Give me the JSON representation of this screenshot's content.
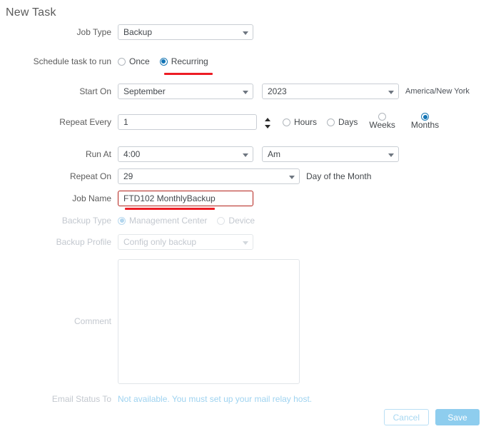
{
  "page_title": "New Task",
  "fields": {
    "job_type": {
      "label": "Job Type",
      "value": "Backup"
    },
    "schedule": {
      "label": "Schedule task to run",
      "option_once": "Once",
      "option_recurring": "Recurring"
    },
    "start_on": {
      "label": "Start On",
      "month": "September",
      "year": "2023",
      "timezone": "America/New York"
    },
    "repeat_every": {
      "label": "Repeat Every",
      "value": "1",
      "unit_hours": "Hours",
      "unit_days": "Days",
      "unit_weeks": "Weeks",
      "unit_months": "Months"
    },
    "run_at": {
      "label": "Run At",
      "time": "4:00",
      "meridiem": "Am"
    },
    "repeat_on": {
      "label": "Repeat On",
      "value": "29",
      "suffix": "Day of the Month"
    },
    "job_name": {
      "label": "Job Name",
      "value": "FTD102 MonthlyBackup"
    },
    "backup_type": {
      "label": "Backup Type",
      "option_management_center": "Management Center",
      "option_device": "Device"
    },
    "backup_profile": {
      "label": "Backup Profile",
      "value": "Config only backup"
    },
    "comment": {
      "label": "Comment",
      "value": ""
    },
    "email_status_to": {
      "label": "Email Status To",
      "message": "Not available. You must set up your mail relay host."
    }
  },
  "footer": {
    "cancel_label": "Cancel",
    "save_label": "Save"
  },
  "colors": {
    "accent_blue": "#1074b5",
    "annotation_red": "#ed1c24",
    "disabled_gray": "#c3c8cf",
    "save_button": "#8ecdee"
  }
}
